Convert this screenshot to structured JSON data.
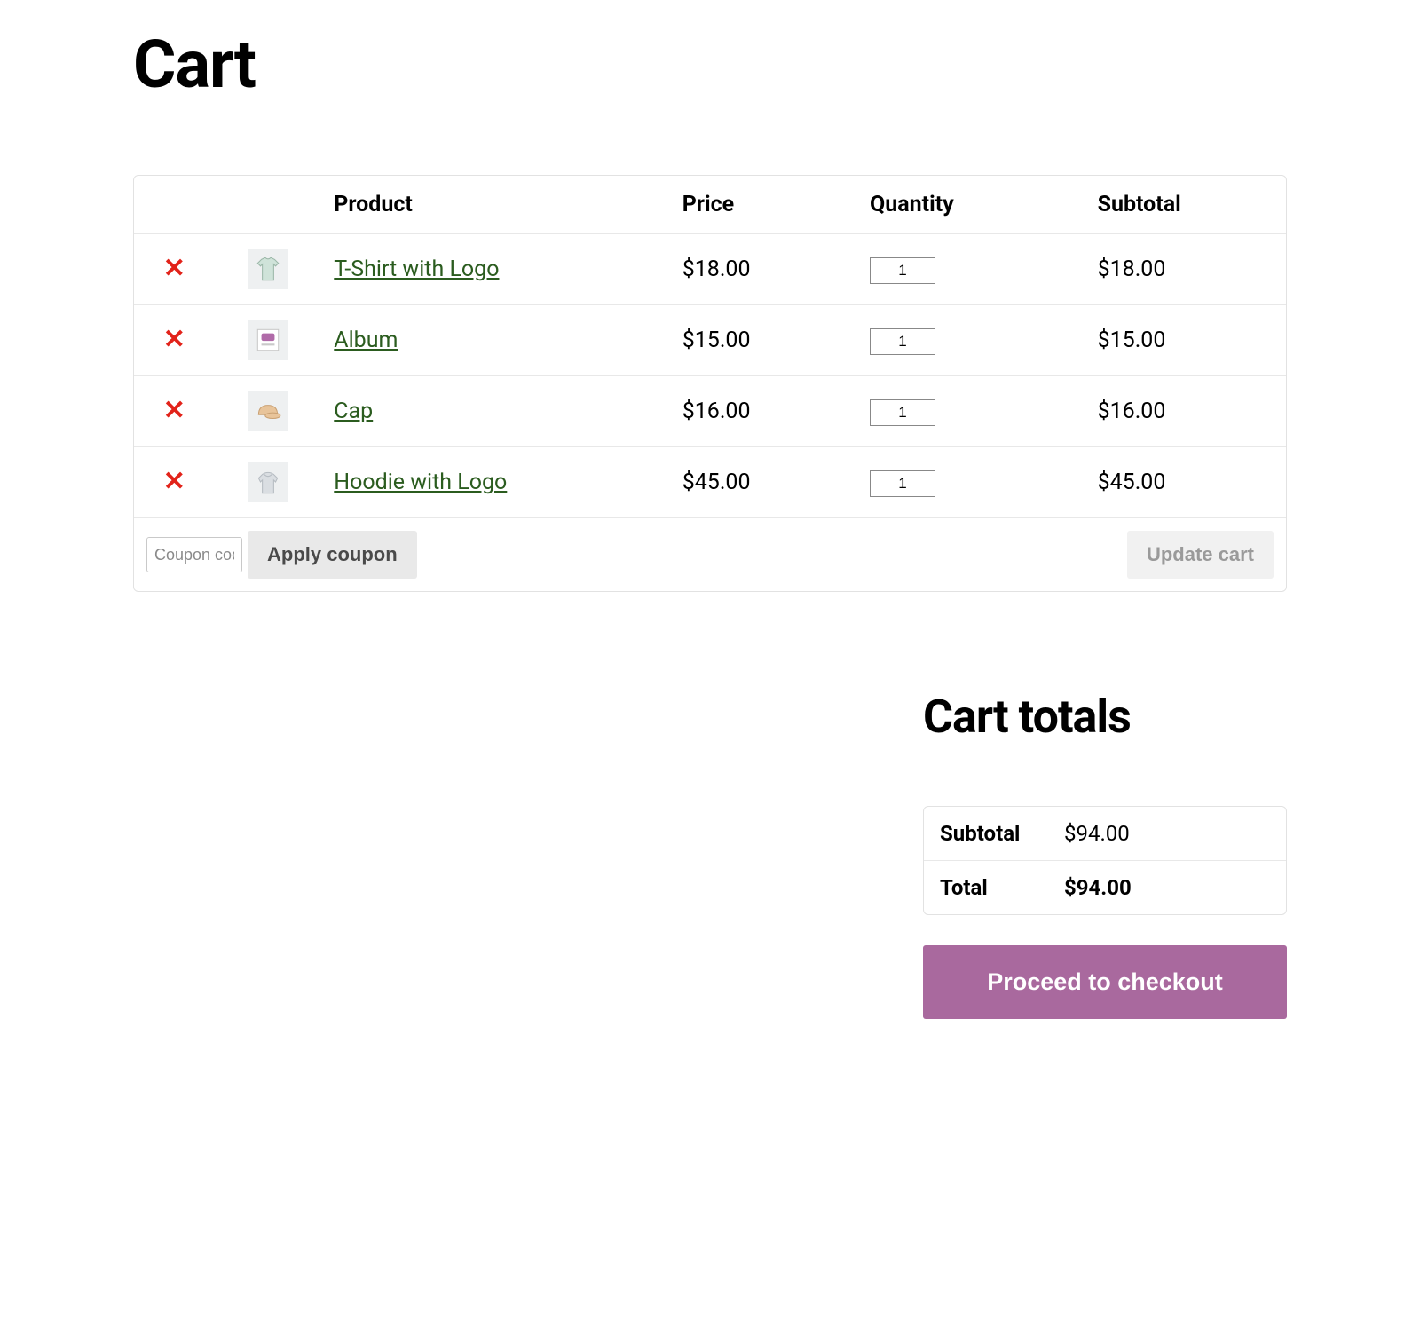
{
  "page": {
    "title": "Cart"
  },
  "table": {
    "headers": {
      "product": "Product",
      "price": "Price",
      "quantity": "Quantity",
      "subtotal": "Subtotal"
    },
    "items": [
      {
        "name": "T-Shirt with Logo",
        "price": "$18.00",
        "qty": "1",
        "subtotal": "$18.00",
        "icon": "tshirt"
      },
      {
        "name": "Album",
        "price": "$15.00",
        "qty": "1",
        "subtotal": "$15.00",
        "icon": "album"
      },
      {
        "name": "Cap",
        "price": "$16.00",
        "qty": "1",
        "subtotal": "$16.00",
        "icon": "cap"
      },
      {
        "name": "Hoodie with Logo",
        "price": "$45.00",
        "qty": "1",
        "subtotal": "$45.00",
        "icon": "hoodie"
      }
    ],
    "coupon_placeholder": "Coupon code",
    "apply_coupon_label": "Apply coupon",
    "update_cart_label": "Update cart"
  },
  "totals": {
    "title": "Cart totals",
    "subtotal_label": "Subtotal",
    "subtotal_value": "$94.00",
    "total_label": "Total",
    "total_value": "$94.00",
    "checkout_label": "Proceed to checkout"
  }
}
